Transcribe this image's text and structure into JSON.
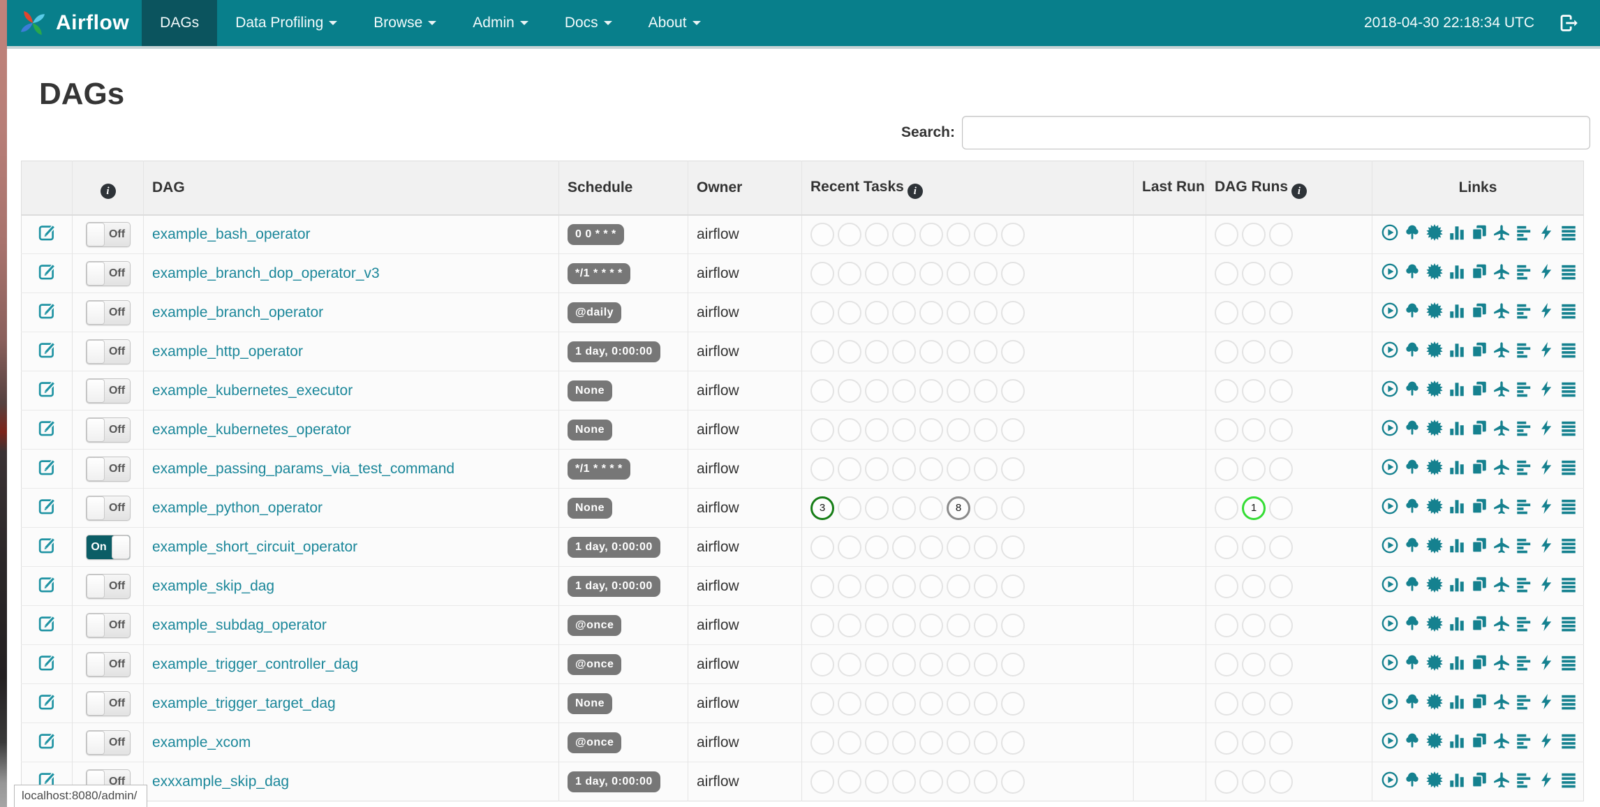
{
  "navbar": {
    "brand": "Airflow",
    "items": [
      {
        "label": "DAGs",
        "active": true,
        "dropdown": false
      },
      {
        "label": "Data Profiling",
        "active": false,
        "dropdown": true
      },
      {
        "label": "Browse",
        "active": false,
        "dropdown": true
      },
      {
        "label": "Admin",
        "active": false,
        "dropdown": true
      },
      {
        "label": "Docs",
        "active": false,
        "dropdown": true
      },
      {
        "label": "About",
        "active": false,
        "dropdown": true
      }
    ],
    "clock": "2018-04-30 22:18:34 UTC",
    "logout_icon": "sign-out-icon"
  },
  "page": {
    "title": "DAGs",
    "search_label": "Search:",
    "search_value": "",
    "status_bar": "localhost:8080/admin/"
  },
  "table": {
    "headers": {
      "info": "",
      "dag": "DAG",
      "schedule": "Schedule",
      "owner": "Owner",
      "recent_tasks": "Recent Tasks",
      "last_run": "Last Run",
      "dag_runs": "DAG Runs",
      "links": "Links"
    },
    "link_titles": [
      "Trigger Dag",
      "Tree View",
      "Graph View",
      "Task Duration",
      "Task Tries",
      "Landing Times",
      "Gantt View",
      "Code View",
      "Logs",
      "Refresh"
    ],
    "link_icons": [
      "play-circle-icon",
      "tree-icon",
      "sunburst-icon",
      "bar-chart-icon",
      "copy-icon",
      "plane-icon",
      "gantt-icon",
      "bolt-icon",
      "list-icon",
      "refresh-icon"
    ],
    "state_colors": {
      "success": "#177e17",
      "running": "#35dd35",
      "queued": "#8a8a8a"
    },
    "recent_task_slots": 8,
    "dag_run_slots": 3,
    "rows": [
      {
        "dag": "example_bash_operator",
        "schedule": "0 0 * * *",
        "owner": "airflow",
        "toggle": "Off",
        "tasks": {},
        "runs": {}
      },
      {
        "dag": "example_branch_dop_operator_v3",
        "schedule": "*/1 * * * *",
        "owner": "airflow",
        "toggle": "Off",
        "tasks": {},
        "runs": {}
      },
      {
        "dag": "example_branch_operator",
        "schedule": "@daily",
        "owner": "airflow",
        "toggle": "Off",
        "tasks": {},
        "runs": {}
      },
      {
        "dag": "example_http_operator",
        "schedule": "1 day, 0:00:00",
        "owner": "airflow",
        "toggle": "Off",
        "tasks": {},
        "runs": {}
      },
      {
        "dag": "example_kubernetes_executor",
        "schedule": "None",
        "owner": "airflow",
        "toggle": "Off",
        "tasks": {},
        "runs": {}
      },
      {
        "dag": "example_kubernetes_operator",
        "schedule": "None",
        "owner": "airflow",
        "toggle": "Off",
        "tasks": {},
        "runs": {}
      },
      {
        "dag": "example_passing_params_via_test_command",
        "schedule": "*/1 * * * *",
        "owner": "airflow",
        "toggle": "Off",
        "tasks": {},
        "runs": {}
      },
      {
        "dag": "example_python_operator",
        "schedule": "None",
        "owner": "airflow",
        "toggle": "Off",
        "tasks": {
          "0": {
            "value": "3",
            "state": "success"
          },
          "5": {
            "value": "8",
            "state": "queued"
          }
        },
        "runs": {
          "1": {
            "value": "1",
            "state": "running"
          }
        }
      },
      {
        "dag": "example_short_circuit_operator",
        "schedule": "1 day, 0:00:00",
        "owner": "airflow",
        "toggle": "On",
        "tasks": {},
        "runs": {}
      },
      {
        "dag": "example_skip_dag",
        "schedule": "1 day, 0:00:00",
        "owner": "airflow",
        "toggle": "Off",
        "tasks": {},
        "runs": {}
      },
      {
        "dag": "example_subdag_operator",
        "schedule": "@once",
        "owner": "airflow",
        "toggle": "Off",
        "tasks": {},
        "runs": {}
      },
      {
        "dag": "example_trigger_controller_dag",
        "schedule": "@once",
        "owner": "airflow",
        "toggle": "Off",
        "tasks": {},
        "runs": {}
      },
      {
        "dag": "example_trigger_target_dag",
        "schedule": "None",
        "owner": "airflow",
        "toggle": "Off",
        "tasks": {},
        "runs": {}
      },
      {
        "dag": "example_xcom",
        "schedule": "@once",
        "owner": "airflow",
        "toggle": "Off",
        "tasks": {},
        "runs": {}
      },
      {
        "dag": "exxxample_skip_dag",
        "schedule": "1 day, 0:00:00",
        "owner": "airflow",
        "toggle": "Off",
        "tasks": {},
        "runs": {}
      }
    ]
  },
  "colors": {
    "navbar": "#087f8b",
    "navbar_active": "#0b545e",
    "link_teal": "#1b879a",
    "badge_bg": "#777777",
    "toggle_on": "#0b5d66"
  }
}
